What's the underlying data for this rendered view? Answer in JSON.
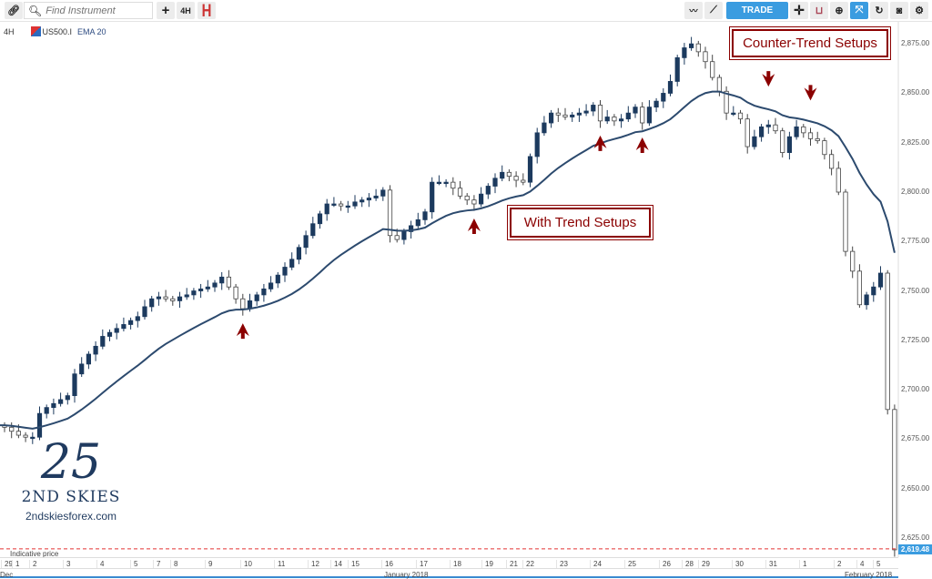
{
  "toolbar": {
    "search_placeholder": "Find Instrument",
    "timeframe_label": "4H",
    "trade_label": "TRADE",
    "left_icons": [
      "link-icon",
      "search-icon",
      "plus-icon",
      "candlestick-icon"
    ],
    "right_icons": [
      "indicators-icon",
      "line-tool-icon",
      "crosshair-icon",
      "curve-tool-icon",
      "zoom-in-icon",
      "fit-icon",
      "refresh-icon",
      "camera-icon",
      "gear-icon"
    ]
  },
  "header": {
    "timeframe": "4H",
    "symbol": "US500.I",
    "indicator": "EMA 20"
  },
  "annotations": {
    "counter_trend": "Counter-Trend Setups",
    "with_trend": "With Trend Setups"
  },
  "logo": {
    "mark": "25",
    "name": "2ND SKIES",
    "url": "2ndskiesforex.com"
  },
  "indicative": {
    "label": "Indicative price",
    "price": "2,619.48"
  },
  "colors": {
    "up": "#1c3a5e",
    "down": "#ffffff",
    "ema": "#2c4a6e",
    "accent": "#3a9ce0",
    "annotation": "#8b0000",
    "indicative": "#e33333"
  },
  "chart_data": {
    "type": "candlestick",
    "indicator": {
      "type": "EMA",
      "period": 20
    },
    "ylim": [
      2612,
      2882
    ],
    "y_ticks": [
      "2,875.00",
      "2,850.00",
      "2,825.00",
      "2,800.00",
      "2,775.00",
      "2,750.00",
      "2,725.00",
      "2,700.00",
      "2,675.00",
      "2,650.00",
      "2,625.00"
    ],
    "x_ticks": [
      "29",
      "1",
      "2",
      "3",
      "4",
      "5",
      "7",
      "8",
      "9",
      "10",
      "11",
      "12",
      "14",
      "15",
      "16",
      "17",
      "18",
      "19",
      "21",
      "22",
      "23",
      "24",
      "25",
      "26",
      "28",
      "29",
      "30",
      "31",
      "1",
      "2",
      "4",
      "5"
    ],
    "x_months": [
      "Dec",
      "January 2018",
      "February 2018"
    ],
    "closes": [
      2681,
      2679,
      2677,
      2676,
      2676,
      2688,
      2691,
      2693,
      2695,
      2697,
      2708,
      2713,
      2718,
      2722,
      2727,
      2729,
      2731,
      2733,
      2735,
      2737,
      2742,
      2746,
      2747,
      2746,
      2745,
      2747,
      2748,
      2750,
      2751,
      2752,
      2754,
      2757,
      2752,
      2746,
      2741,
      2745,
      2748,
      2751,
      2754,
      2758,
      2762,
      2766,
      2772,
      2778,
      2784,
      2789,
      2794,
      2794,
      2793,
      2793,
      2795,
      2796,
      2797,
      2798,
      2801,
      2778,
      2776,
      2780,
      2783,
      2786,
      2790,
      2805,
      2805,
      2805,
      2802,
      2798,
      2796,
      2794,
      2799,
      2803,
      2807,
      2810,
      2808,
      2806,
      2805,
      2818,
      2830,
      2835,
      2840,
      2839,
      2838,
      2839,
      2840,
      2841,
      2844,
      2836,
      2838,
      2836,
      2837,
      2840,
      2843,
      2835,
      2843,
      2846,
      2850,
      2856,
      2868,
      2873,
      2875,
      2871,
      2866,
      2858,
      2851,
      2840,
      2840,
      2837,
      2823,
      2828,
      2833,
      2834,
      2831,
      2820,
      2828,
      2833,
      2830,
      2827,
      2826,
      2819,
      2812,
      2800,
      2770,
      2760,
      2743,
      2748,
      2752,
      2759,
      2690,
      2619
    ],
    "setup_markers": {
      "with_trend": [
        34,
        67,
        85,
        91
      ],
      "counter_trend": [
        109,
        115
      ]
    },
    "last_price": 2619.48
  }
}
